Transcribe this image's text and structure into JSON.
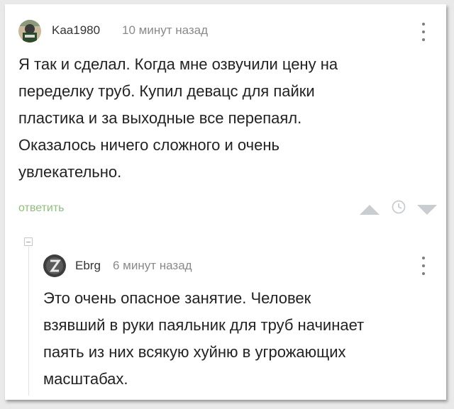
{
  "comment1": {
    "author": "Kaa1980",
    "time": "10 минут назад",
    "lines": [
      "Я так и сделал. Когда мне озвучили цену на",
      "переделку труб. Купил девацс для пайки",
      "пластика и за выходные все перепаял.",
      "Оказалось ничего сложного и очень",
      "увлекательно."
    ],
    "reply_label": "ответить"
  },
  "comment2": {
    "author": "Ebrg",
    "time": "6 минут назад",
    "lines": [
      "Это очень опасное занятие. Человек",
      "взявший в руки паяльник для труб начинает",
      "паять из них всякую хуйню в угрожающих",
      "масштабах."
    ]
  },
  "icons": [
    "avatar-kaa1980",
    "avatar-ebrg",
    "more-options-icon",
    "upvote-icon",
    "clock-icon",
    "downvote-icon",
    "collapse-thread-icon"
  ],
  "colors": {
    "reply_link": "#8ec07a",
    "vote_arrows": "#c9ccd0",
    "meta_text": "#8a8a8a"
  }
}
